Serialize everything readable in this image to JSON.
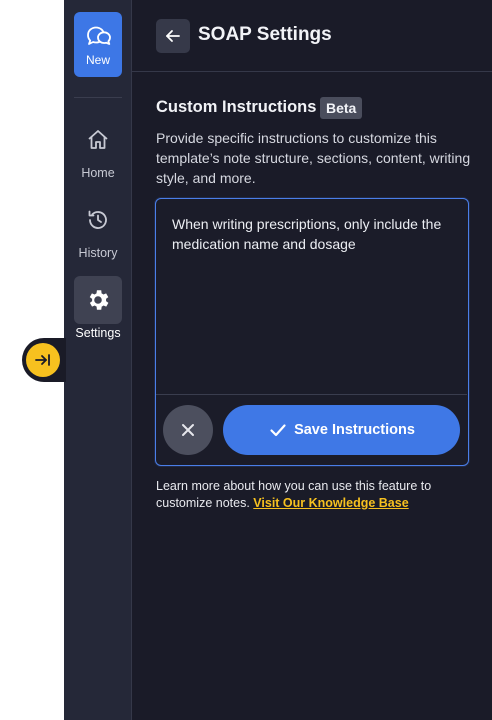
{
  "sidebar": {
    "new_label": "New",
    "items": [
      {
        "label": "Home",
        "icon": "home-icon"
      },
      {
        "label": "History",
        "icon": "history-icon"
      },
      {
        "label": "Settings",
        "icon": "gear-icon"
      }
    ],
    "active": "Settings"
  },
  "header": {
    "title": "SOAP Settings"
  },
  "custom_instructions": {
    "title": "Custom Instructions",
    "badge": "Beta",
    "description": "Provide specific instructions to customize this template’s note structure, sections, content, writing style, and more.",
    "value": "When writing prescriptions, only include the medication name and dosage",
    "save_label": "Save Instructions"
  },
  "help": {
    "text": "Learn more about how you can use this feature to customize notes.",
    "link_label": "Visit Our Knowledge Base"
  },
  "colors": {
    "accent": "#3f78e6",
    "highlight": "#f7c11f",
    "sidebar_bg": "#252838",
    "main_bg": "#1a1b28"
  }
}
